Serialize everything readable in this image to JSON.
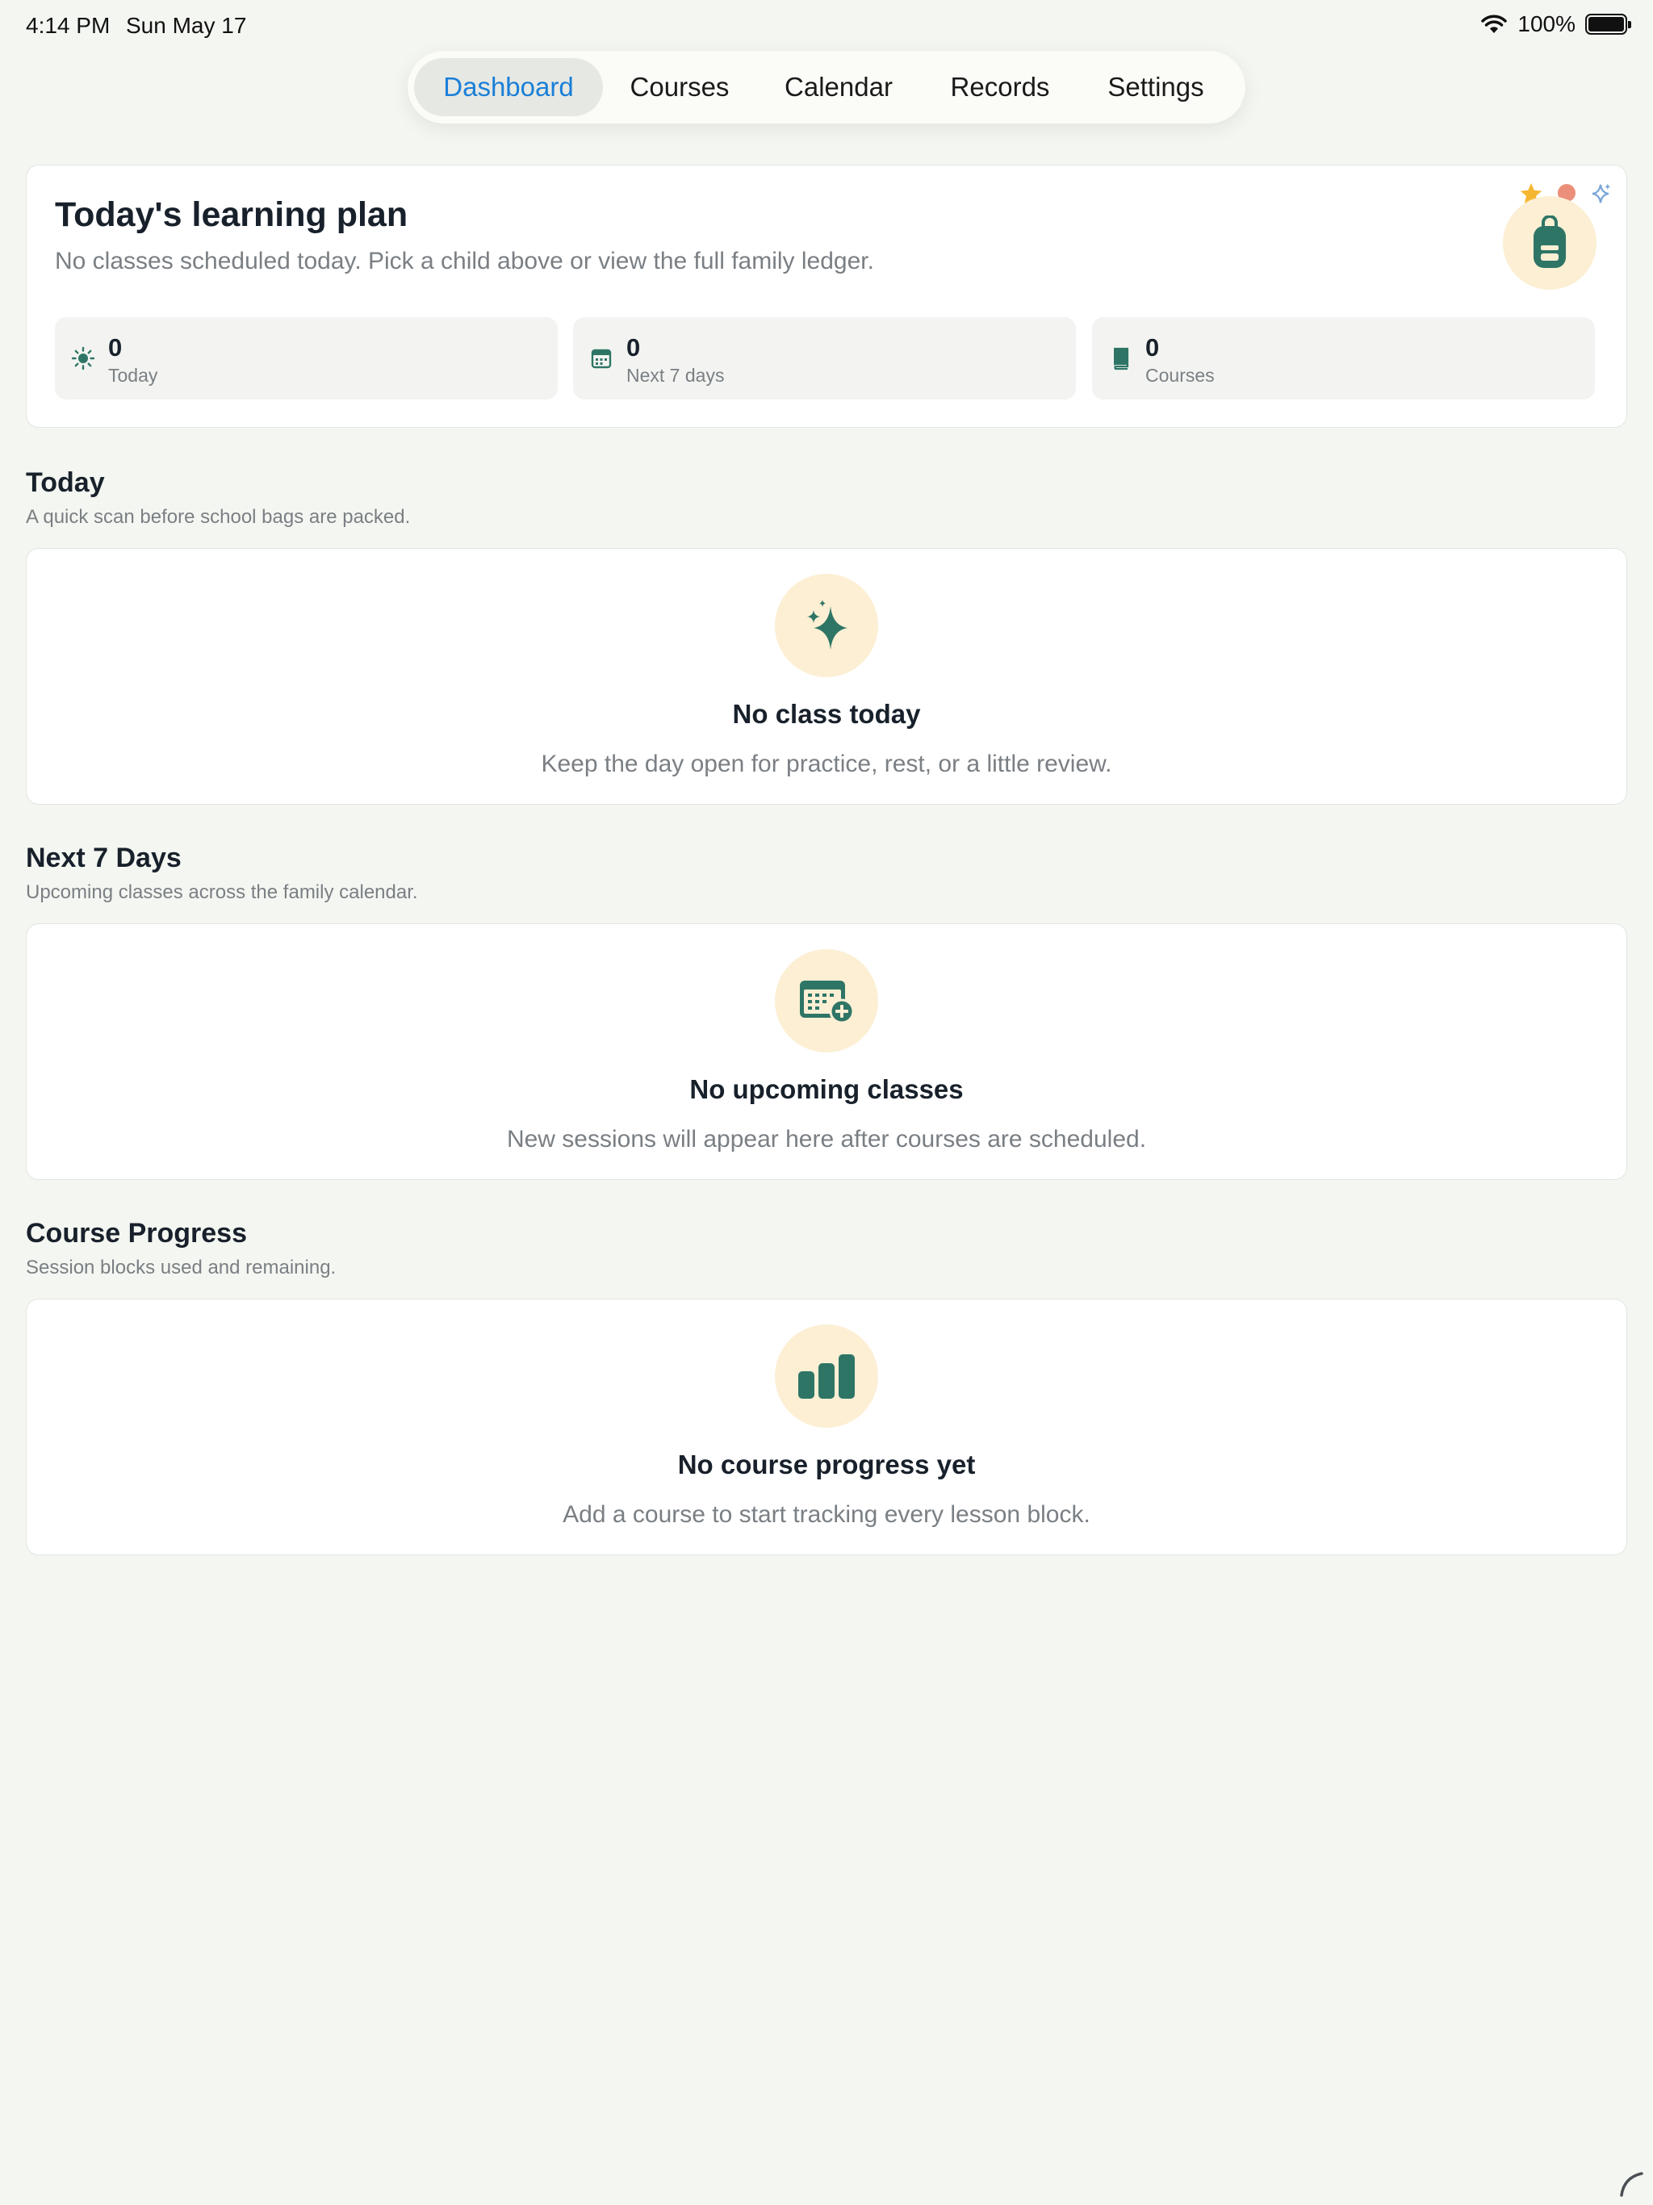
{
  "status_bar": {
    "time": "4:14 PM",
    "date": "Sun May 17",
    "battery": "100%",
    "icons": [
      "wifi-icon",
      "battery-icon"
    ]
  },
  "tabs": [
    {
      "label": "Dashboard",
      "active": true
    },
    {
      "label": "Courses",
      "active": false
    },
    {
      "label": "Calendar",
      "active": false
    },
    {
      "label": "Records",
      "active": false
    },
    {
      "label": "Settings",
      "active": false
    }
  ],
  "hero": {
    "title": "Today's learning plan",
    "subtitle": "No classes scheduled today. Pick a child above or view the full family ledger.",
    "badge_icon": "backpack-icon",
    "decorations": [
      "star-icon",
      "dot-icon",
      "sparkle-icon"
    ],
    "stats": [
      {
        "icon": "sun-icon",
        "value": "0",
        "label": "Today"
      },
      {
        "icon": "calendar-icon",
        "value": "0",
        "label": "Next 7 days"
      },
      {
        "icon": "book-icon",
        "value": "0",
        "label": "Courses"
      }
    ]
  },
  "sections": {
    "today": {
      "title": "Today",
      "subtitle": "A quick scan before school bags are packed.",
      "empty_icon": "sparkles-icon",
      "empty_title": "No class today",
      "empty_subtitle": "Keep the day open for practice, rest, or a little review."
    },
    "next7": {
      "title": "Next 7 Days",
      "subtitle": "Upcoming classes across the family calendar.",
      "empty_icon": "calendar-add-icon",
      "empty_title": "No upcoming classes",
      "empty_subtitle": "New sessions will appear here after courses are scheduled."
    },
    "progress": {
      "title": "Course Progress",
      "subtitle": "Session blocks used and remaining.",
      "empty_icon": "bar-chart-icon",
      "empty_title": "No course progress yet",
      "empty_subtitle": "Add a course to start tracking every lesson block."
    }
  },
  "colors": {
    "accent": "#1a7fd8",
    "icon_green": "#2e7566",
    "badge_bg": "#fcefd4",
    "page_bg": "#f4f6f1",
    "star": "#f5b731",
    "dot": "#ec8f7a",
    "sparkle": "#7aa6d8"
  }
}
